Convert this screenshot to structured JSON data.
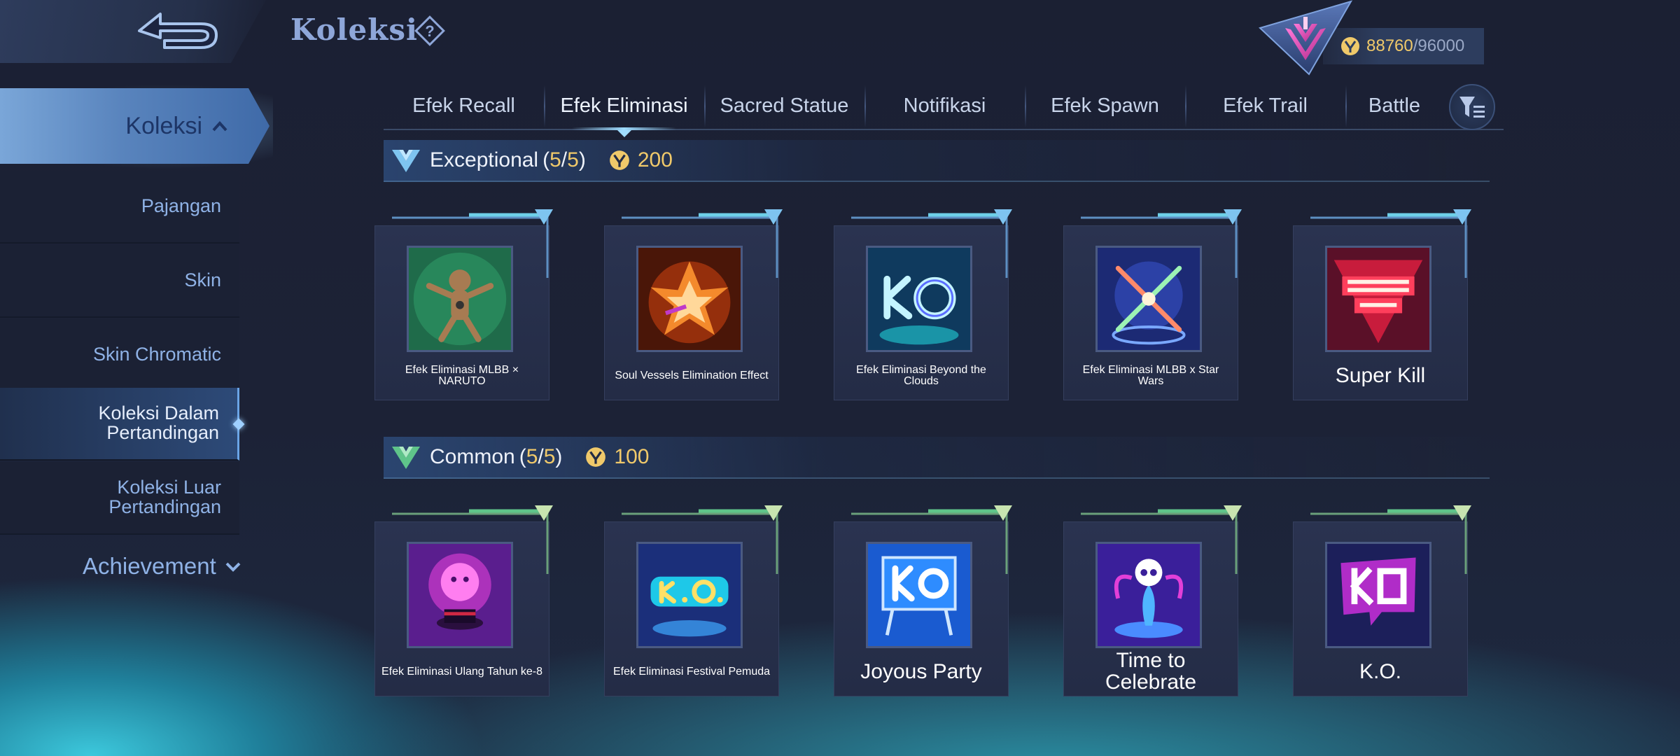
{
  "header": {
    "title": "Koleksi",
    "points_current": "88760",
    "points_separator": "/",
    "points_max": "96000"
  },
  "sidebar": {
    "main": "Koleksi",
    "items": [
      "Pajangan",
      "Skin",
      "Skin Chromatic",
      "Koleksi Dalam Pertandingan",
      "Koleksi Luar Pertandingan"
    ],
    "active_index": 3,
    "achievement": "Achievement"
  },
  "tabs": [
    "Efek Recall",
    "Efek Eliminasi",
    "Sacred Statue",
    "Notifikasi",
    "Efek Spawn",
    "Efek Trail",
    "Battle"
  ],
  "active_tab": 1,
  "sections": [
    {
      "tier": "Exceptional",
      "count_open": "(",
      "count_have": "5",
      "count_sep": "/",
      "count_total": "5",
      "count_close": ")",
      "cost": "200",
      "items": [
        {
          "name": "Efek Eliminasi MLBB × NARUTO",
          "icon": "naruto-doll"
        },
        {
          "name": "Soul Vessels Elimination Effect",
          "icon": "fire-burst"
        },
        {
          "name": "Efek Eliminasi Beyond the Clouds",
          "icon": "ko-neon-blue"
        },
        {
          "name": "Efek Eliminasi MLBB x Star Wars",
          "icon": "crossed-lightsabers"
        },
        {
          "name": "Super Kill",
          "icon": "super-kill-badge"
        }
      ]
    },
    {
      "tier": "Common",
      "count_open": "(",
      "count_have": "5",
      "count_sep": "/",
      "count_total": "5",
      "count_close": ")",
      "cost": "100",
      "items": [
        {
          "name": "Efek Eliminasi Ulang Tahun ke-8",
          "icon": "birthday-magic-hat"
        },
        {
          "name": "Efek Eliminasi Festival Pemuda",
          "icon": "ko-festival"
        },
        {
          "name": "Joyous Party",
          "icon": "ko-billboard"
        },
        {
          "name": "Time to Celebrate",
          "icon": "skull-fountain"
        },
        {
          "name": "K.O.",
          "icon": "ko-pixel-bubble"
        }
      ]
    }
  ],
  "colors": {
    "gold": "#f0c96a",
    "sidebar_text": "#8fb2e6",
    "title": "#8ea6d8"
  }
}
